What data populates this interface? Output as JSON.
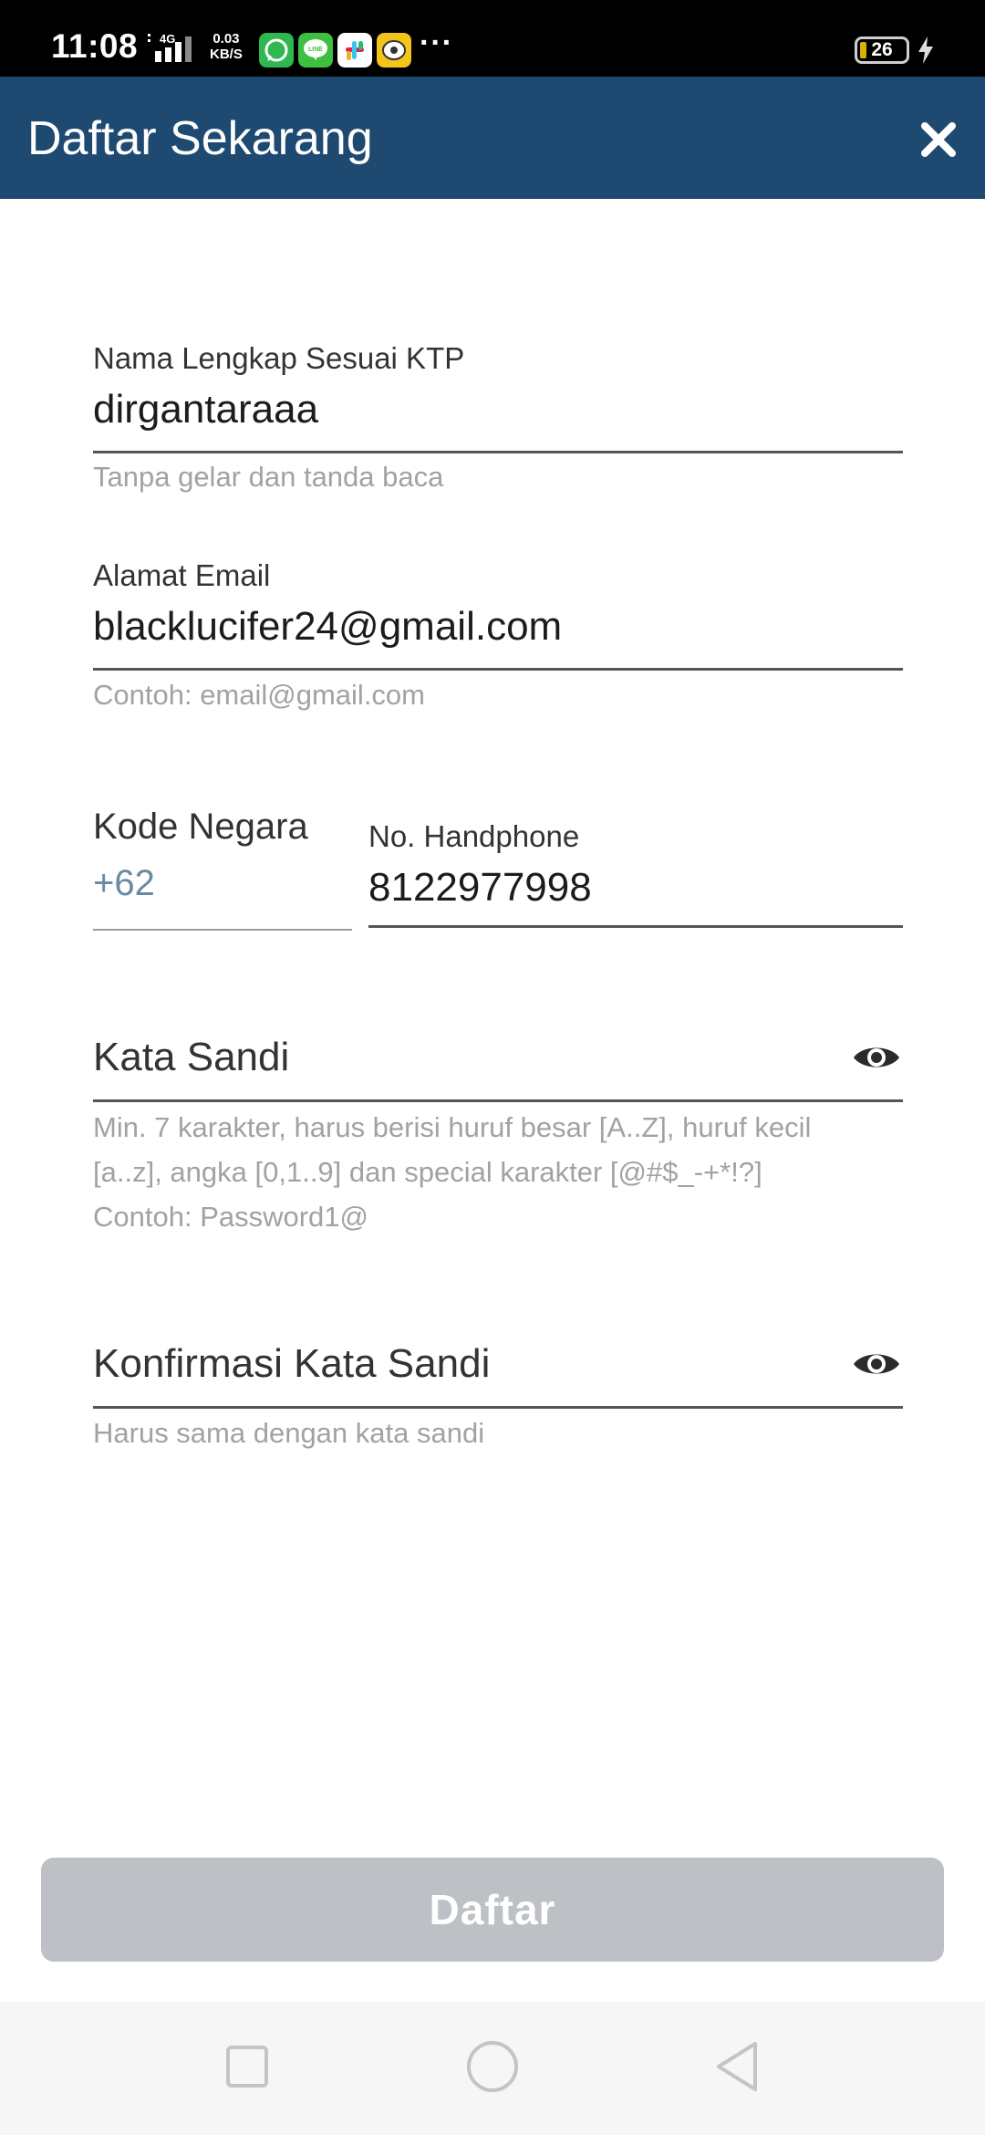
{
  "status_bar": {
    "time": "11:08",
    "network_type": "4G",
    "net_speed_value": "0.03",
    "net_speed_unit": "KB/S",
    "apps": [
      "whatsapp-icon",
      "line-icon",
      "slack-icon",
      "app-notification-icon"
    ],
    "more": "···",
    "battery_level": "26",
    "charging": true
  },
  "app_bar": {
    "title": "Daftar Sekarang",
    "close_icon": "close-icon"
  },
  "form": {
    "full_name": {
      "label": "Nama Lengkap Sesuai KTP",
      "value": "dirgantaraaa",
      "helper": "Tanpa gelar dan tanda baca"
    },
    "email": {
      "label": "Alamat Email",
      "value": "blacklucifer24@gmail.com",
      "helper": "Contoh: email@gmail.com"
    },
    "country_code": {
      "label": "Kode Negara",
      "value": "+62"
    },
    "phone": {
      "label": "No. Handphone",
      "value": "8122977998"
    },
    "password": {
      "placeholder": "Kata Sandi",
      "helper_lines": [
        "Min. 7 karakter, harus berisi huruf besar [A..Z], huruf kecil",
        "[a..z], angka [0,1..9] dan special karakter [@#$_-+*!?]",
        "Contoh: Password1@"
      ]
    },
    "confirm_password": {
      "placeholder": "Konfirmasi Kata Sandi",
      "helper": "Harus sama dengan kata sandi"
    },
    "submit_label": "Daftar"
  },
  "colors": {
    "app_bar": "#1e4a72",
    "submit_disabled": "#bdc0c4",
    "helper_text": "#a2a2a2",
    "country_code_text": "#6a8aa0"
  }
}
